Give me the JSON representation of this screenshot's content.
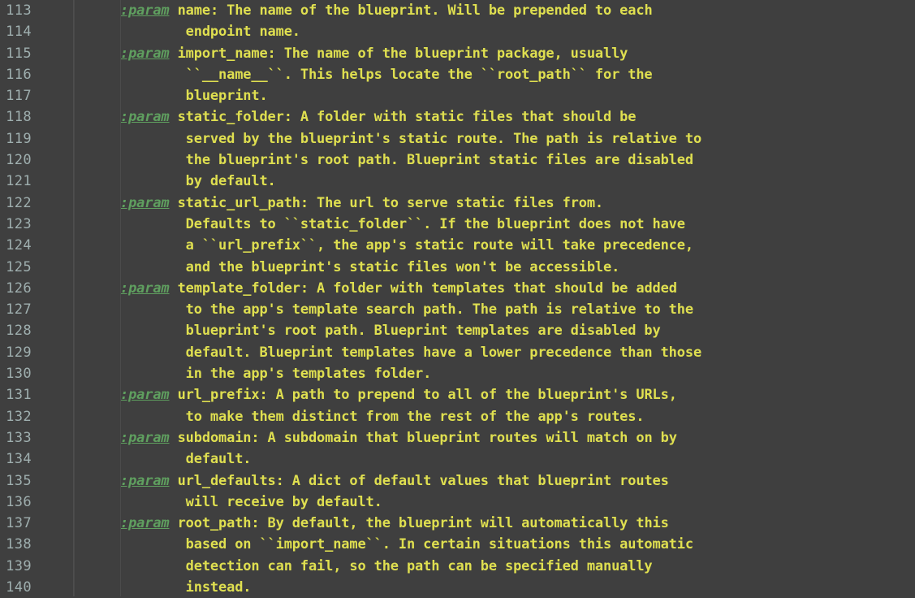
{
  "editor": {
    "theme_name": "zenburn",
    "colors": {
      "background": "#3f3f3f",
      "text": "#dfdf50",
      "keyword": "#5f9f5f",
      "line_number": "#9fafaf",
      "gutter_border": "#4a4a4a",
      "indent_guide": "#4b4b4b"
    },
    "first_line_number": 113,
    "last_line_number": 140
  },
  "lines": [
    {
      "number": "113",
      "keyword": ":param",
      "text": " name: The name of the blueprint. Will be prepended to each"
    },
    {
      "number": "114",
      "keyword": "",
      "text": "        endpoint name."
    },
    {
      "number": "115",
      "keyword": ":param",
      "text": " import_name: The name of the blueprint package, usually"
    },
    {
      "number": "116",
      "keyword": "",
      "text": "        ``__name__``. This helps locate the ``root_path`` for the"
    },
    {
      "number": "117",
      "keyword": "",
      "text": "        blueprint."
    },
    {
      "number": "118",
      "keyword": ":param",
      "text": " static_folder: A folder with static files that should be"
    },
    {
      "number": "119",
      "keyword": "",
      "text": "        served by the blueprint's static route. The path is relative to"
    },
    {
      "number": "120",
      "keyword": "",
      "text": "        the blueprint's root path. Blueprint static files are disabled"
    },
    {
      "number": "121",
      "keyword": "",
      "text": "        by default."
    },
    {
      "number": "122",
      "keyword": ":param",
      "text": " static_url_path: The url to serve static files from."
    },
    {
      "number": "123",
      "keyword": "",
      "text": "        Defaults to ``static_folder``. If the blueprint does not have"
    },
    {
      "number": "124",
      "keyword": "",
      "text": "        a ``url_prefix``, the app's static route will take precedence,"
    },
    {
      "number": "125",
      "keyword": "",
      "text": "        and the blueprint's static files won't be accessible."
    },
    {
      "number": "126",
      "keyword": ":param",
      "text": " template_folder: A folder with templates that should be added"
    },
    {
      "number": "127",
      "keyword": "",
      "text": "        to the app's template search path. The path is relative to the"
    },
    {
      "number": "128",
      "keyword": "",
      "text": "        blueprint's root path. Blueprint templates are disabled by"
    },
    {
      "number": "129",
      "keyword": "",
      "text": "        default. Blueprint templates have a lower precedence than those"
    },
    {
      "number": "130",
      "keyword": "",
      "text": "        in the app's templates folder."
    },
    {
      "number": "131",
      "keyword": ":param",
      "text": " url_prefix: A path to prepend to all of the blueprint's URLs,"
    },
    {
      "number": "132",
      "keyword": "",
      "text": "        to make them distinct from the rest of the app's routes."
    },
    {
      "number": "133",
      "keyword": ":param",
      "text": " subdomain: A subdomain that blueprint routes will match on by"
    },
    {
      "number": "134",
      "keyword": "",
      "text": "        default."
    },
    {
      "number": "135",
      "keyword": ":param",
      "text": " url_defaults: A dict of default values that blueprint routes"
    },
    {
      "number": "136",
      "keyword": "",
      "text": "        will receive by default."
    },
    {
      "number": "137",
      "keyword": ":param",
      "text": " root_path: By default, the blueprint will automatically this"
    },
    {
      "number": "138",
      "keyword": "",
      "text": "        based on ``import_name``. In certain situations this automatic"
    },
    {
      "number": "139",
      "keyword": "",
      "text": "        detection can fail, so the path can be specified manually"
    },
    {
      "number": "140",
      "keyword": "",
      "text": "        instead."
    }
  ]
}
